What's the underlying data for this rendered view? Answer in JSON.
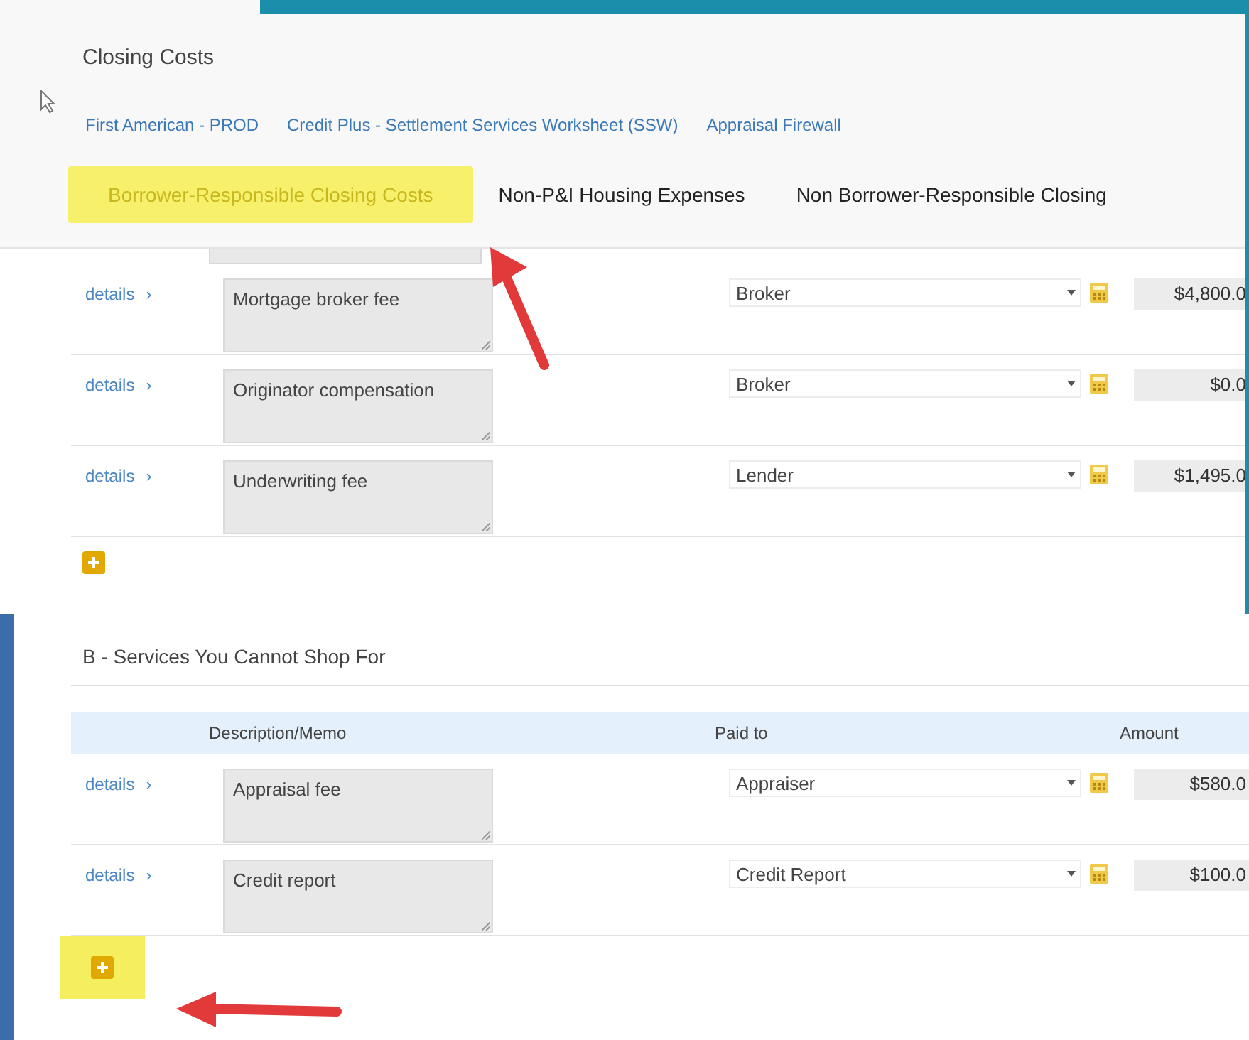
{
  "page": {
    "title": "Closing Costs"
  },
  "links": [
    "First American - PROD",
    "Credit Plus - Settlement Services Worksheet (SSW)",
    "Appraisal Firewall"
  ],
  "tabs": [
    {
      "label": "Borrower-Responsible Closing Costs",
      "selected": true
    },
    {
      "label": "Non-P&I Housing Expenses",
      "selected": false
    },
    {
      "label": "Non Borrower-Responsible Closing",
      "selected": false
    }
  ],
  "sections": [
    {
      "rows": [
        {
          "details": "details",
          "caret": "›",
          "description": "Mortgage broker fee",
          "paid_to": "Broker",
          "amount": "$4,800.0"
        },
        {
          "details": "details",
          "caret": "›",
          "description": "Originator compensation",
          "paid_to": "Broker",
          "amount": "$0.0"
        },
        {
          "details": "details",
          "caret": "›",
          "description": "Underwriting fee",
          "paid_to": "Lender",
          "amount": "$1,495.0"
        }
      ]
    },
    {
      "title": "B - Services You Cannot Shop For",
      "columns": [
        "Description/Memo",
        "Paid to",
        "Amount"
      ],
      "rows": [
        {
          "details": "details",
          "caret": "›",
          "description": "Appraisal fee",
          "paid_to": "Appraiser",
          "amount": "$580.0"
        },
        {
          "details": "details",
          "caret": "›",
          "description": "Credit report",
          "paid_to": "Credit Report",
          "amount": "$100.0"
        }
      ]
    }
  ]
}
